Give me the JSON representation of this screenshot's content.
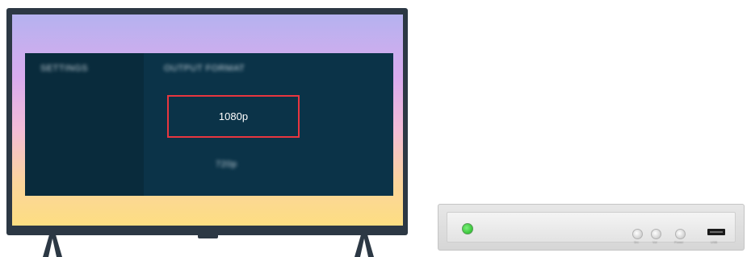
{
  "tv": {
    "menu": {
      "sidebar_heading": "SETTINGS",
      "section_heading": "OUTPUT FORMAT",
      "selected_option": "1080p",
      "other_option": "720p"
    }
  },
  "set_top_box": {
    "button_labels": [
      "Src",
      "Vol",
      "Power"
    ],
    "usb_label": "USB",
    "led_color": "#2ecc2e"
  },
  "colors": {
    "highlight": "#e8363f",
    "menu_bg": "#0b3348",
    "tv_frame": "#2c3844"
  }
}
